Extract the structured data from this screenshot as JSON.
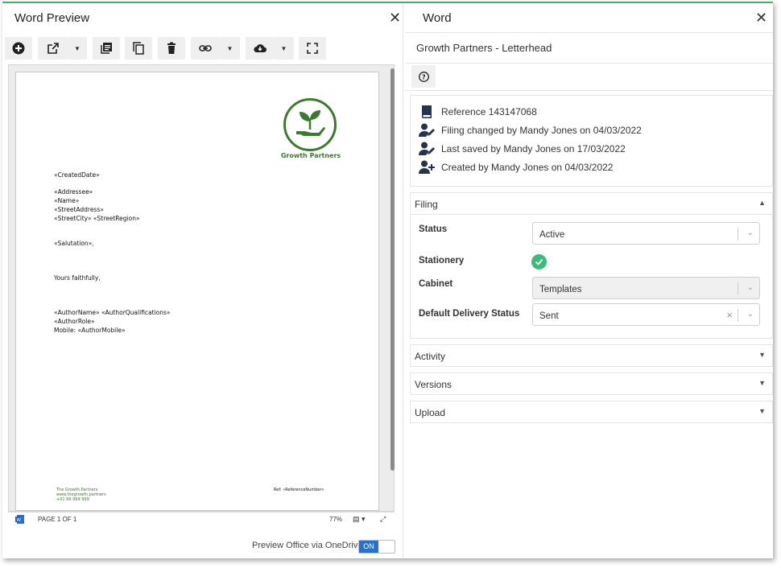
{
  "preview": {
    "title": "Word Preview",
    "toolbar": [
      "add",
      "open-external",
      "open-options",
      "library",
      "copy",
      "delete",
      "link",
      "link-options",
      "download",
      "download-options",
      "fullscreen"
    ],
    "document": {
      "logo_text": "Growth Partners",
      "created_date": "«CreatedDate»",
      "address": "«Addressee»\n«Name»\n«StreetAddress»\n«StreetCity» «StreetRegion»",
      "salutation": "«Salutation»,",
      "closing": "Yours faithfully,",
      "author": "«AuthorName» «AuthorQualifications»\n«AuthorRole»\nMobile: «AuthorMobile»",
      "footer_company": "The Growth Partners",
      "footer_web": "www.thegrowth.partners",
      "footer_phone": "+01 99 999 999",
      "footer_ref": "Ref: «ReferenceNumber»"
    },
    "status": {
      "page": "PAGE 1 OF 1",
      "zoom": "77%"
    },
    "onedrive_label": "Preview Office via OneDrive",
    "toggle_label": "ON"
  },
  "panel": {
    "title": "Word",
    "doc_name": "Growth Partners - Letterhead",
    "info": {
      "reference": "Reference 143147068",
      "filing_changed": "Filing changed by Mandy Jones on 04/03/2022",
      "last_saved": "Last saved by Mandy Jones on 17/03/2022",
      "created": "Created by Mandy Jones on 04/03/2022"
    },
    "filing": {
      "heading": "Filing",
      "status_label": "Status",
      "status_value": "Active",
      "stationery_label": "Stationery",
      "stationery_checked": true,
      "cabinet_label": "Cabinet",
      "cabinet_value": "Templates",
      "delivery_label": "Default Delivery Status",
      "delivery_value": "Sent"
    },
    "sections": {
      "activity": "Activity",
      "versions": "Versions",
      "upload": "Upload"
    }
  },
  "colors": {
    "accent_green": "#3d7a2f",
    "toggle_blue": "#2b72c6",
    "check_green": "#3cba7a",
    "icon_navy": "#24344d"
  }
}
